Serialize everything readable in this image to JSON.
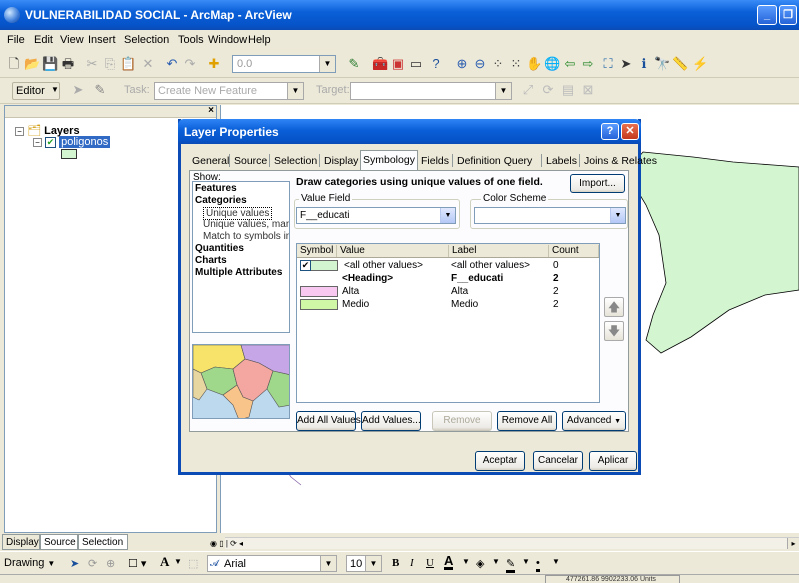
{
  "window": {
    "title": "VULNERABILIDAD SOCIAL - ArcMap - ArcView"
  },
  "menu": [
    "File",
    "Edit",
    "View",
    "Insert",
    "Selection",
    "Tools",
    "Window",
    "Help"
  ],
  "toolbar": {
    "scale_value": "0.0"
  },
  "editor": {
    "label": "Editor",
    "task_label": "Task:",
    "task_value": "Create New Feature",
    "target_label": "Target:"
  },
  "toc": {
    "root": "Layers",
    "layer": "poligonos"
  },
  "toc_tabs": [
    "Display",
    "Source",
    "Selection"
  ],
  "dialog": {
    "title": "Layer Properties",
    "tabs": [
      "General",
      "Source",
      "Selection",
      "Display",
      "Symbology",
      "Fields",
      "Definition Query",
      "Labels",
      "Joins & Relates"
    ],
    "active_tab": "Symbology",
    "show_label": "Show:",
    "show_items": [
      {
        "label": "Features",
        "style": "b"
      },
      {
        "label": "Categories",
        "style": "b"
      },
      {
        "label": "Unique values",
        "style": "sub"
      },
      {
        "label": "Unique values, many f",
        "style": "sub"
      },
      {
        "label": "Match to symbols in a",
        "style": "sub"
      },
      {
        "label": "Quantities",
        "style": "b"
      },
      {
        "label": "Charts",
        "style": "b"
      },
      {
        "label": "Multiple Attributes",
        "style": "b"
      }
    ],
    "heading": "Draw categories using unique values of one field.",
    "import_label": "Import...",
    "value_field_label": "Value Field",
    "value_field": "F__educati",
    "color_scheme_label": "Color Scheme",
    "color_scheme": [
      "#f7c9ef",
      "#d8e8ff",
      "#fff3c2",
      "#c8f5c5",
      "#ffd1d1",
      "#e0ccff",
      "#c9f3ff",
      "#f9f7c4",
      "#ffc9e6",
      "#d4ffd4"
    ],
    "columns": {
      "symbol": "Symbol",
      "value": "Value",
      "label": "Label",
      "count": "Count"
    },
    "rows": [
      {
        "value": "<all other values>",
        "label": "<all other values>",
        "count": "0",
        "swatch": "#d3f5d0",
        "checked": true,
        "bold": false
      },
      {
        "value": "<Heading>",
        "label": "F__educati",
        "count": "2",
        "swatch": "",
        "checked": false,
        "bold": true
      },
      {
        "value": "Alta",
        "label": "Alta",
        "count": "2",
        "swatch": "#f8c8f0",
        "checked": false,
        "bold": false
      },
      {
        "value": "Medio",
        "label": "Medio",
        "count": "2",
        "swatch": "#cff7a6",
        "checked": false,
        "bold": false
      }
    ],
    "buttons": {
      "add_all": "Add All Values",
      "add": "Add Values...",
      "remove": "Remove",
      "remove_all": "Remove All",
      "advanced": "Advanced",
      "ok": "Aceptar",
      "cancel": "Cancelar",
      "apply": "Aplicar"
    }
  },
  "drawing": {
    "label": "Drawing",
    "font": "Arial",
    "size": "10"
  },
  "status": {
    "coord": "477261.86  9902233.06 Units"
  }
}
